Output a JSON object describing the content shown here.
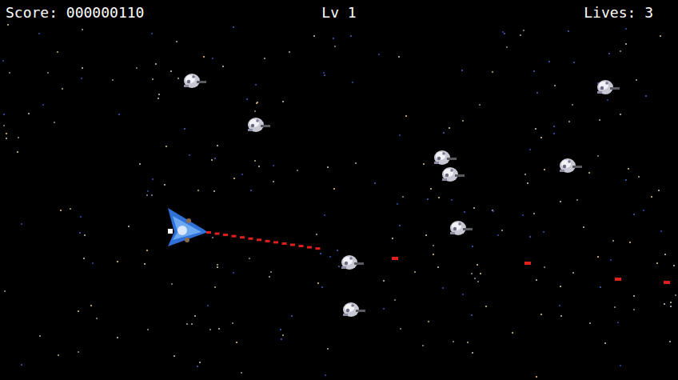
{
  "hud": {
    "score": "Score: 000000110",
    "level": "Lv 1",
    "lives": "Lives: 3"
  }
}
